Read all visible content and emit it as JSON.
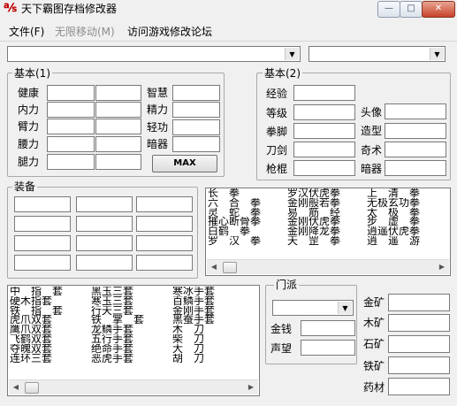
{
  "window": {
    "title": "天下霸图存档修改器"
  },
  "menu": {
    "file": "文件(F)",
    "move": "无限移动(M)",
    "forum": "访问游戏修改论坛"
  },
  "basic1": {
    "legend": "基本(1)",
    "left_labels": [
      "健康",
      "内力",
      "臂力",
      "腰力",
      "腿力"
    ],
    "right_labels": [
      "智慧",
      "精力",
      "轻功",
      "暗器"
    ],
    "max_button": "MAX"
  },
  "basic2": {
    "legend": "基本(2)",
    "left_labels": [
      "经验",
      "等级",
      "拳脚",
      "刀剑",
      "枪棍"
    ],
    "right_labels": [
      "头像",
      "造型",
      "奇术",
      "暗器"
    ]
  },
  "equip": {
    "legend": "装备"
  },
  "skills_list": {
    "col1": [
      "长　拳",
      "六　合　拳",
      "灵　蛇　拳",
      "摧心断骨拳",
      "白鹤　拳",
      "罗　汉　拳"
    ],
    "col2": [
      "罗汉伏虎拳",
      "金刚般若拳",
      "易　筋　经",
      "金刚伏虎拳",
      "金刚降龙拳",
      "天　罡　拳"
    ],
    "col3": [
      "上　清　拳",
      "无极玄功拳",
      "太　极　拳",
      "步　虚　拳",
      "逍遥伏虎拳",
      "逍　遥　游"
    ]
  },
  "items_list": {
    "col1": [
      "中　指　套",
      "硬木指套",
      "铁　指　套",
      "虎爪双套",
      "鹰爪双套",
      "飞鹤双套",
      "夺魄双套",
      "连环三套"
    ],
    "col2": [
      "黑玉三套",
      "寒玉三套",
      "行天三套",
      "铁　掌　套",
      "龙鳞手套",
      "五行手套",
      "绝命手套",
      "恶虎手套"
    ],
    "col3": [
      "寒冰手套",
      "百鳞手套",
      "金刚手套",
      "黑蚕手套",
      "木　刀",
      "柴　刀",
      "大　刀",
      "胡　刀"
    ]
  },
  "faction": {
    "legend": "门派",
    "money_label": "金钱",
    "fame_label": "声望",
    "ore_labels": [
      "金矿",
      "木矿",
      "石矿",
      "铁矿",
      "药材"
    ]
  }
}
